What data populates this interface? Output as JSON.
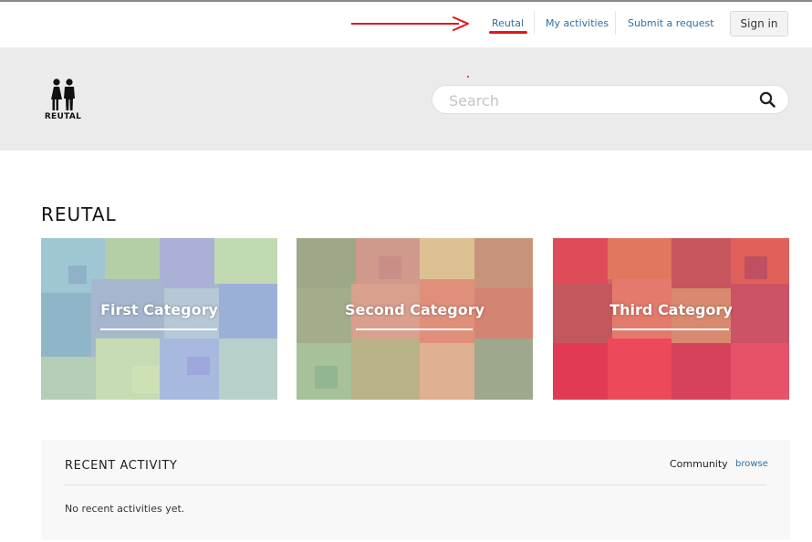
{
  "nav": {
    "links": [
      {
        "label": "Reutal"
      },
      {
        "label": "My activities"
      },
      {
        "label": "Submit a request"
      }
    ],
    "signin_label": "Sign in"
  },
  "header": {
    "logo_text": "REUTAL",
    "search_placeholder": "Search"
  },
  "page_title": "REUTAL",
  "categories": [
    {
      "label": "First Category"
    },
    {
      "label": "Second Category"
    },
    {
      "label": "Third Category"
    }
  ],
  "recent": {
    "title": "RECENT ACTIVITY",
    "community_label": "Community",
    "browse_label": "browse",
    "empty_text": "No recent activities yet."
  },
  "colors": {
    "link": "#2f6fa5",
    "annotation_red": "#e0161b",
    "header_bg": "#ebebeb"
  }
}
